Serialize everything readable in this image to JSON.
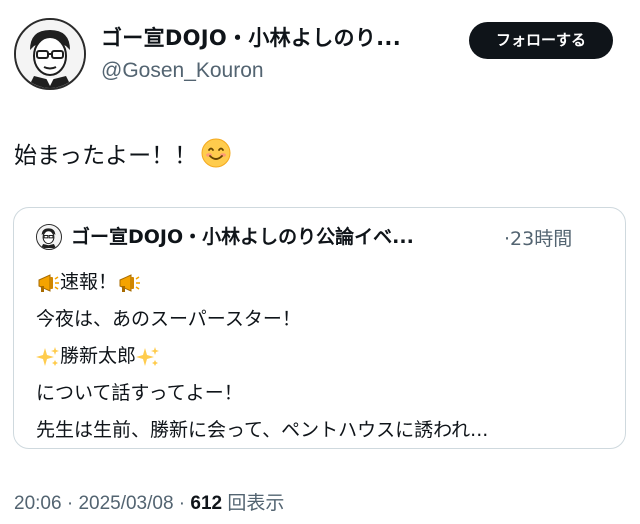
{
  "author": {
    "display_name": "ゴー宣DOJO・小林よしのり...",
    "handle": "@Gosen_Kouron",
    "avatar_icon": "cartoon-portrait-avatar"
  },
  "follow_button": {
    "label": "フォローする"
  },
  "tweet": {
    "text": "始まったよー！！",
    "emoji": "smiling-face-icon"
  },
  "quote": {
    "display_name": "ゴー宣DOJO・小林よしのり公論イベ...",
    "time": "·23時間",
    "lines": [
      {
        "prefix_icon": "megaphone-icon",
        "text": "速報！",
        "suffix_icon": "megaphone-icon"
      },
      {
        "text": "今夜は、あのスーパースター！"
      },
      {
        "prefix_icon": "sparkles-icon",
        "text": "勝新太郎",
        "suffix_icon": "sparkles-icon"
      },
      {
        "text": "について話すってよー！"
      },
      {
        "text": "先生は生前、勝新に会って、ペントハウスに誘われ..."
      }
    ]
  },
  "meta": {
    "time": "20:06",
    "sep1": " · ",
    "date": "2025/03/08",
    "sep2": " · ",
    "views_count": "612",
    "views_label": " 回表示"
  },
  "colors": {
    "text": "#0f1419",
    "secondary": "#536471",
    "border": "#cfd9de",
    "button_bg": "#0f1419"
  }
}
